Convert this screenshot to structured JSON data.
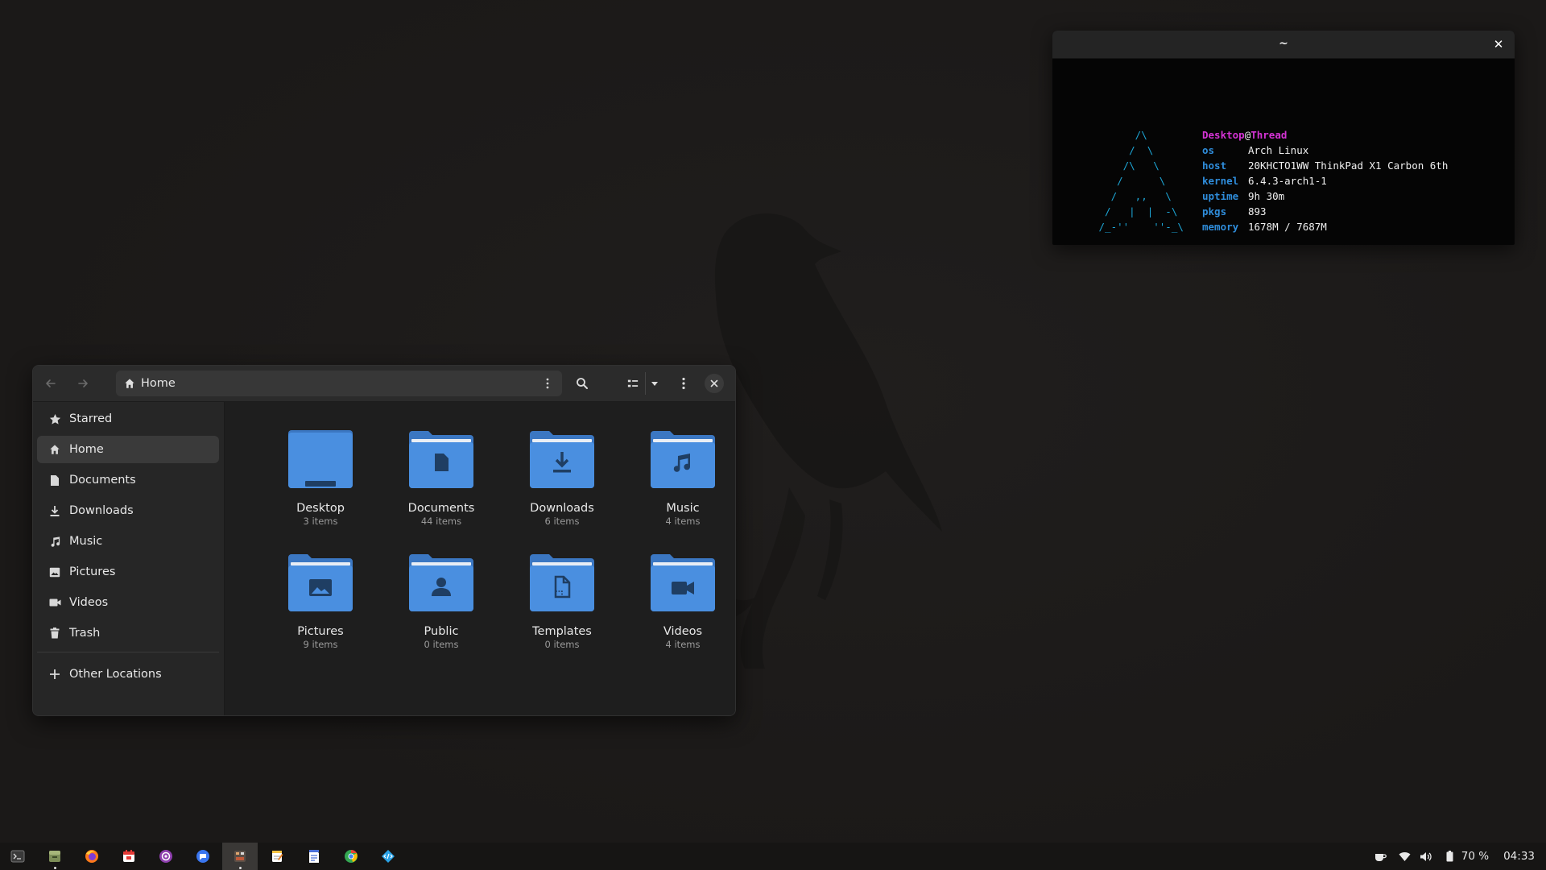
{
  "terminal": {
    "title": "~",
    "close_symbol": "✕",
    "logo": "       /\\\n      /  \\\n     /\\   \\\n    /      \\\n   /   ,,   \\\n  /   |  |  -\\\n /_-''    ''-_\\",
    "user": "Desktop",
    "at": "@",
    "host": "Thread",
    "info": [
      {
        "key": "os",
        "value": "Arch Linux"
      },
      {
        "key": "host",
        "value": "20KHCTO1WW ThinkPad X1 Carbon 6th"
      },
      {
        "key": "kernel",
        "value": "6.4.3-arch1-1"
      },
      {
        "key": "uptime",
        "value": "9h 30m"
      },
      {
        "key": "pkgs",
        "value": "893"
      },
      {
        "key": "memory",
        "value": "1678M / 7687M"
      }
    ],
    "colors": {
      "logo": "#1da6d6",
      "key": "#2f8ddb",
      "user": "#d433d4"
    }
  },
  "files": {
    "path": {
      "label": "Home",
      "icon": "home-icon"
    },
    "toolbar": {
      "back_icon": "arrow-left-icon",
      "forward_icon": "arrow-right-icon",
      "search_icon": "search-icon",
      "view_icon": "list-view-icon",
      "view_dropdown_icon": "chevron-down-icon",
      "menu_icon": "kebab-menu-icon",
      "close_icon": "close-icon"
    },
    "sidebar": {
      "items": [
        {
          "label": "Starred",
          "icon": "star-icon"
        },
        {
          "label": "Home",
          "icon": "home-icon"
        },
        {
          "label": "Documents",
          "icon": "document-icon"
        },
        {
          "label": "Downloads",
          "icon": "download-icon"
        },
        {
          "label": "Music",
          "icon": "music-icon"
        },
        {
          "label": "Pictures",
          "icon": "picture-icon"
        },
        {
          "label": "Videos",
          "icon": "video-icon"
        },
        {
          "label": "Trash",
          "icon": "trash-icon"
        }
      ],
      "other": {
        "label": "Other Locations",
        "icon": "plus-icon"
      }
    },
    "folders": [
      {
        "name": "Desktop",
        "count": "3 items",
        "icon": "desktop-folder-icon"
      },
      {
        "name": "Documents",
        "count": "44 items",
        "icon": "documents-folder-icon"
      },
      {
        "name": "Downloads",
        "count": "6 items",
        "icon": "downloads-folder-icon"
      },
      {
        "name": "Music",
        "count": "4 items",
        "icon": "music-folder-icon"
      },
      {
        "name": "Pictures",
        "count": "9 items",
        "icon": "pictures-folder-icon"
      },
      {
        "name": "Public",
        "count": "0 items",
        "icon": "public-folder-icon"
      },
      {
        "name": "Templates",
        "count": "0 items",
        "icon": "templates-folder-icon"
      },
      {
        "name": "Videos",
        "count": "4 items",
        "icon": "videos-folder-icon"
      }
    ],
    "colors": {
      "folder": "#4a8fe0",
      "folder_dark": "#3b77c2",
      "folder_glyph": "#1f3e63"
    }
  },
  "taskbar": {
    "apps": [
      {
        "name": "terminal",
        "icon": "terminal-icon"
      },
      {
        "name": "files",
        "icon": "file-manager-icon"
      },
      {
        "name": "firefox",
        "icon": "firefox-icon"
      },
      {
        "name": "calendar",
        "icon": "calendar-icon"
      },
      {
        "name": "podcasts",
        "icon": "podcast-icon"
      },
      {
        "name": "chat",
        "icon": "chat-icon"
      },
      {
        "name": "system",
        "icon": "system-app-icon"
      },
      {
        "name": "notes",
        "icon": "notes-icon"
      },
      {
        "name": "text-editor",
        "icon": "text-editor-icon"
      },
      {
        "name": "chrome",
        "icon": "chrome-icon"
      },
      {
        "name": "vscode",
        "icon": "code-editor-icon"
      }
    ],
    "tray": {
      "battery_percent": "70 %",
      "clock": "04:33",
      "icons": [
        "caffeine-icon",
        "wifi-icon",
        "volume-icon",
        "battery-icon"
      ]
    }
  }
}
